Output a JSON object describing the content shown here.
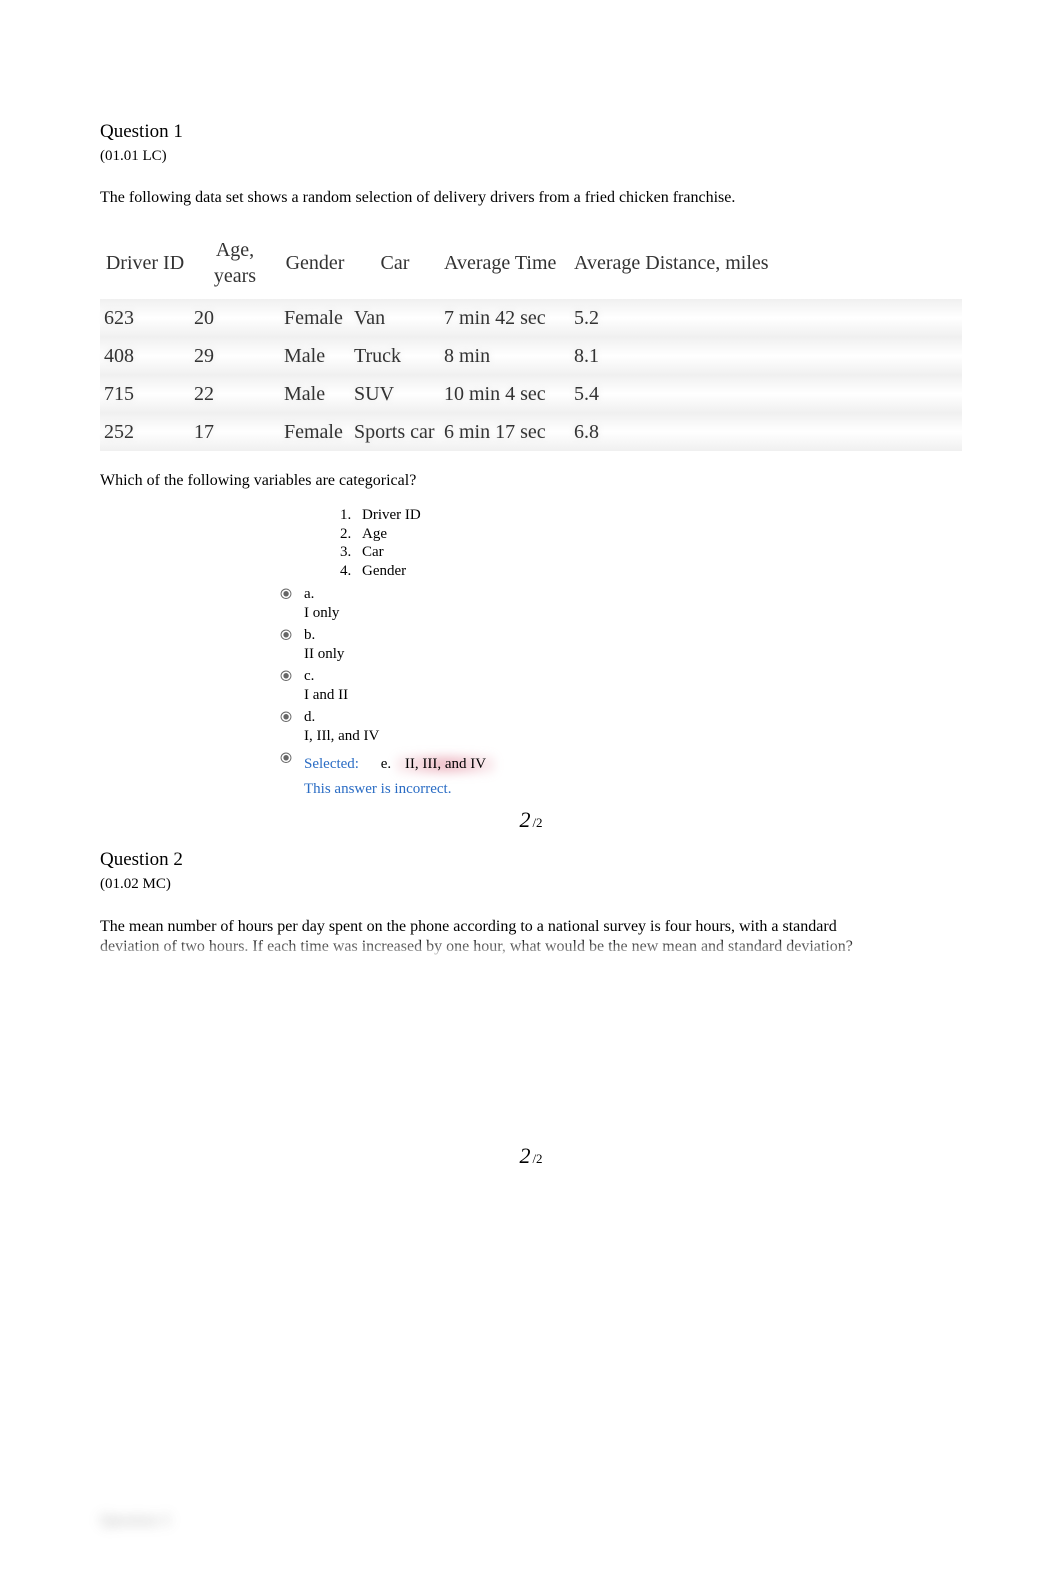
{
  "q1": {
    "title": "Question 1",
    "code": "(01.01 LC)",
    "intro": "The following data set shows a random selection of delivery drivers from a fried chicken franchise.",
    "table": {
      "headers": [
        "Driver ID",
        "Age, years",
        "Gender",
        "Car",
        "Average Time",
        "Average Distance, miles"
      ],
      "rows": [
        [
          "623",
          "20",
          "Female",
          "Van",
          "7 min 42 sec",
          "5.2"
        ],
        [
          "408",
          "29",
          "Male",
          "Truck",
          "8 min",
          "8.1"
        ],
        [
          "715",
          "22",
          "Male",
          "SUV",
          "10 min 4 sec",
          "5.4"
        ],
        [
          "252",
          "17",
          "Female",
          "Sports car",
          "6 min 17 sec",
          "6.8"
        ]
      ]
    },
    "prompt": "Which of the following variables are categorical?",
    "numbered": [
      {
        "n": "1.",
        "t": "Driver ID"
      },
      {
        "n": "2.",
        "t": "Age"
      },
      {
        "n": "3.",
        "t": "Car"
      },
      {
        "n": "4.",
        "t": "Gender"
      }
    ],
    "choices": [
      {
        "letter": "a.",
        "text": "I only"
      },
      {
        "letter": "b.",
        "text": "II only"
      },
      {
        "letter": "c.",
        "text": "I and II"
      },
      {
        "letter": "d.",
        "text": "I, IIl, and IV"
      }
    ],
    "selected": {
      "label": "Selected:",
      "letter": "e.",
      "text": "II, III, and IV"
    },
    "feedback": "This answer is incorrect.",
    "score": {
      "earned": "2",
      "sep": "/2"
    }
  },
  "q2": {
    "title": "Question 2",
    "code": "(01.02 MC)",
    "body": "The mean number of hours per day spent on the phone according to a national survey is four hours, with a standard deviation of two hours. If each time was increased by one hour, what would be the new mean and standard deviation?",
    "score": {
      "earned": "2",
      "sep": "/2"
    }
  },
  "q3": {
    "stub": "Question 3"
  }
}
